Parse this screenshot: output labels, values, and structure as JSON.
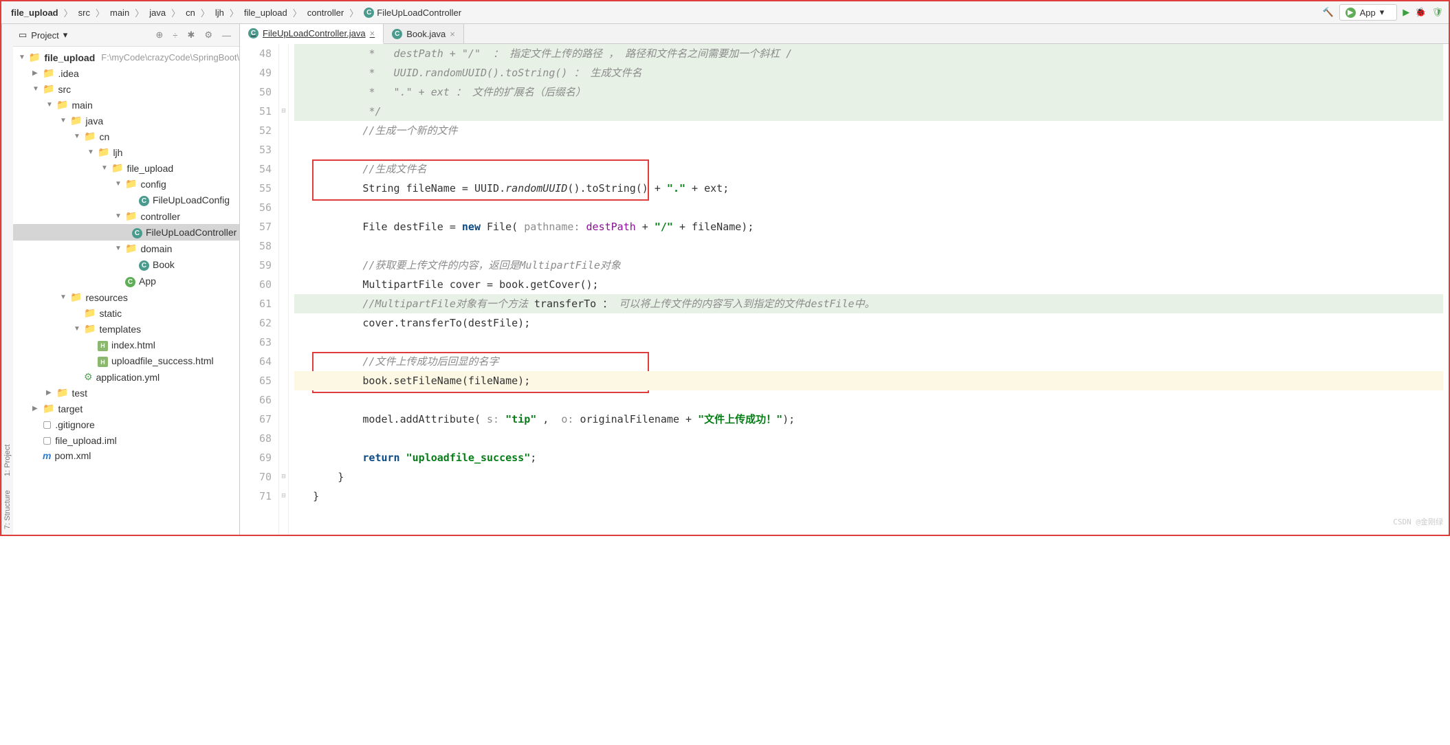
{
  "breadcrumb": [
    "file_upload",
    "src",
    "main",
    "java",
    "cn",
    "ljh",
    "file_upload",
    "controller",
    "FileUpLoadController"
  ],
  "run_config": "App",
  "sidebar": {
    "title": "Project",
    "tools": [
      "⊕",
      "÷",
      "✱",
      "⚙",
      "—"
    ],
    "left_tabs": [
      "1: Project",
      "7: Structure"
    ]
  },
  "tree": [
    {
      "d": 0,
      "a": "▼",
      "i": "folder",
      "t": "file_upload",
      "bold": true,
      "path": "F:\\myCode\\crazyCode\\SpringBoot\\sprin"
    },
    {
      "d": 1,
      "a": "▶",
      "i": "folder",
      "t": ".idea"
    },
    {
      "d": 1,
      "a": "▼",
      "i": "folder",
      "t": "src"
    },
    {
      "d": 2,
      "a": "▼",
      "i": "folder",
      "t": "main"
    },
    {
      "d": 3,
      "a": "▼",
      "i": "folder-teal",
      "t": "java"
    },
    {
      "d": 4,
      "a": "▼",
      "i": "pkg",
      "t": "cn"
    },
    {
      "d": 5,
      "a": "▼",
      "i": "pkg",
      "t": "ljh"
    },
    {
      "d": 6,
      "a": "▼",
      "i": "pkg",
      "t": "file_upload"
    },
    {
      "d": 7,
      "a": "▼",
      "i": "pkg",
      "t": "config"
    },
    {
      "d": 8,
      "a": "",
      "i": "c",
      "t": "FileUpLoadConfig"
    },
    {
      "d": 7,
      "a": "▼",
      "i": "pkg",
      "t": "controller"
    },
    {
      "d": 8,
      "a": "",
      "i": "c",
      "t": "FileUpLoadController",
      "sel": true
    },
    {
      "d": 7,
      "a": "▼",
      "i": "pkg",
      "t": "domain"
    },
    {
      "d": 8,
      "a": "",
      "i": "c",
      "t": "Book"
    },
    {
      "d": 7,
      "a": "",
      "i": "crun",
      "t": "App"
    },
    {
      "d": 3,
      "a": "▼",
      "i": "res",
      "t": "resources"
    },
    {
      "d": 4,
      "a": "",
      "i": "folder",
      "t": "static"
    },
    {
      "d": 4,
      "a": "▼",
      "i": "folder",
      "t": "templates"
    },
    {
      "d": 5,
      "a": "",
      "i": "html",
      "t": "index.html"
    },
    {
      "d": 5,
      "a": "",
      "i": "html",
      "t": "uploadfile_success.html"
    },
    {
      "d": 4,
      "a": "",
      "i": "yml",
      "t": "application.yml"
    },
    {
      "d": 2,
      "a": "▶",
      "i": "folder",
      "t": "test"
    },
    {
      "d": 1,
      "a": "▶",
      "i": "folder-orange",
      "t": "target"
    },
    {
      "d": 1,
      "a": "",
      "i": "git",
      "t": ".gitignore"
    },
    {
      "d": 1,
      "a": "",
      "i": "iml",
      "t": "file_upload.iml"
    },
    {
      "d": 1,
      "a": "",
      "i": "m",
      "t": "pom.xml"
    }
  ],
  "tabs": [
    {
      "label": "FileUpLoadController.java",
      "active": true
    },
    {
      "label": "Book.java",
      "active": false
    }
  ],
  "linesStart": 48,
  "code": {
    "48": {
      "cls": "hl-green",
      "html": "            <span class='cmt'>*   destPath + \"/\"  ： 指定文件上传的路径 ， 路径和文件名之间需要加一个斜杠 /</span>"
    },
    "49": {
      "cls": "hl-green",
      "html": "            <span class='cmt'>*   UUID.randomUUID().toString() ： 生成文件名</span>"
    },
    "50": {
      "cls": "hl-green",
      "html": "            <span class='cmt'>*   \".\" + ext ： 文件的扩展名（后缀名）</span>"
    },
    "51": {
      "cls": "hl-green",
      "html": "            <span class='cmt'>*/</span>"
    },
    "52": {
      "html": "           <span class='cmt'>//生成一个新的文件</span>"
    },
    "53": {
      "html": ""
    },
    "54": {
      "html": "           <span class='cmt'>//生成文件名</span>"
    },
    "55": {
      "html": "           String fileName = UUID.<span class='mth'>randomUUID</span>().toString() + <span class='str'>\".\"</span> + ext;"
    },
    "56": {
      "html": ""
    },
    "57": {
      "html": "           File destFile = <span class='kw'>new</span> File( <span class='prm'>pathname:</span> <span class='fld'>destPath</span> + <span class='str'>\"/\"</span> + fileName);"
    },
    "58": {
      "html": ""
    },
    "59": {
      "html": "           <span class='cmt'>//获取要上传文件的内容，返回是MultipartFile对象</span>"
    },
    "60": {
      "html": "           MultipartFile cover = book.getCover();"
    },
    "61": {
      "cls": "hl-green",
      "html": "           <span class='cmt'>//MultipartFile对象有一个方法 </span>transferTo ：<span class='cmt'> 可以将上传文件的内容写入到指定的文件destFile中。</span>"
    },
    "62": {
      "html": "           cover.transferTo(destFile);"
    },
    "63": {
      "html": ""
    },
    "64": {
      "html": "           <span class='cmt'>//文件上传成功后回显的名字</span>"
    },
    "65": {
      "cls": "hl-yellow",
      "html": "           book.setFileName(fileName);"
    },
    "66": {
      "html": ""
    },
    "67": {
      "html": "           model.addAttribute( <span class='prm'>s:</span> <span class='str'>\"tip\"</span> ,  <span class='prm'>o:</span> originalFilename + <span class='str'>\"文件上传成功！\"</span>);"
    },
    "68": {
      "html": ""
    },
    "69": {
      "html": "           <span class='kw'>return</span> <span class='str'>\"uploadfile_success\"</span>;"
    },
    "70": {
      "html": "       }"
    },
    "71": {
      "html": "   }"
    }
  },
  "watermark": "CSDN @金刚绿"
}
